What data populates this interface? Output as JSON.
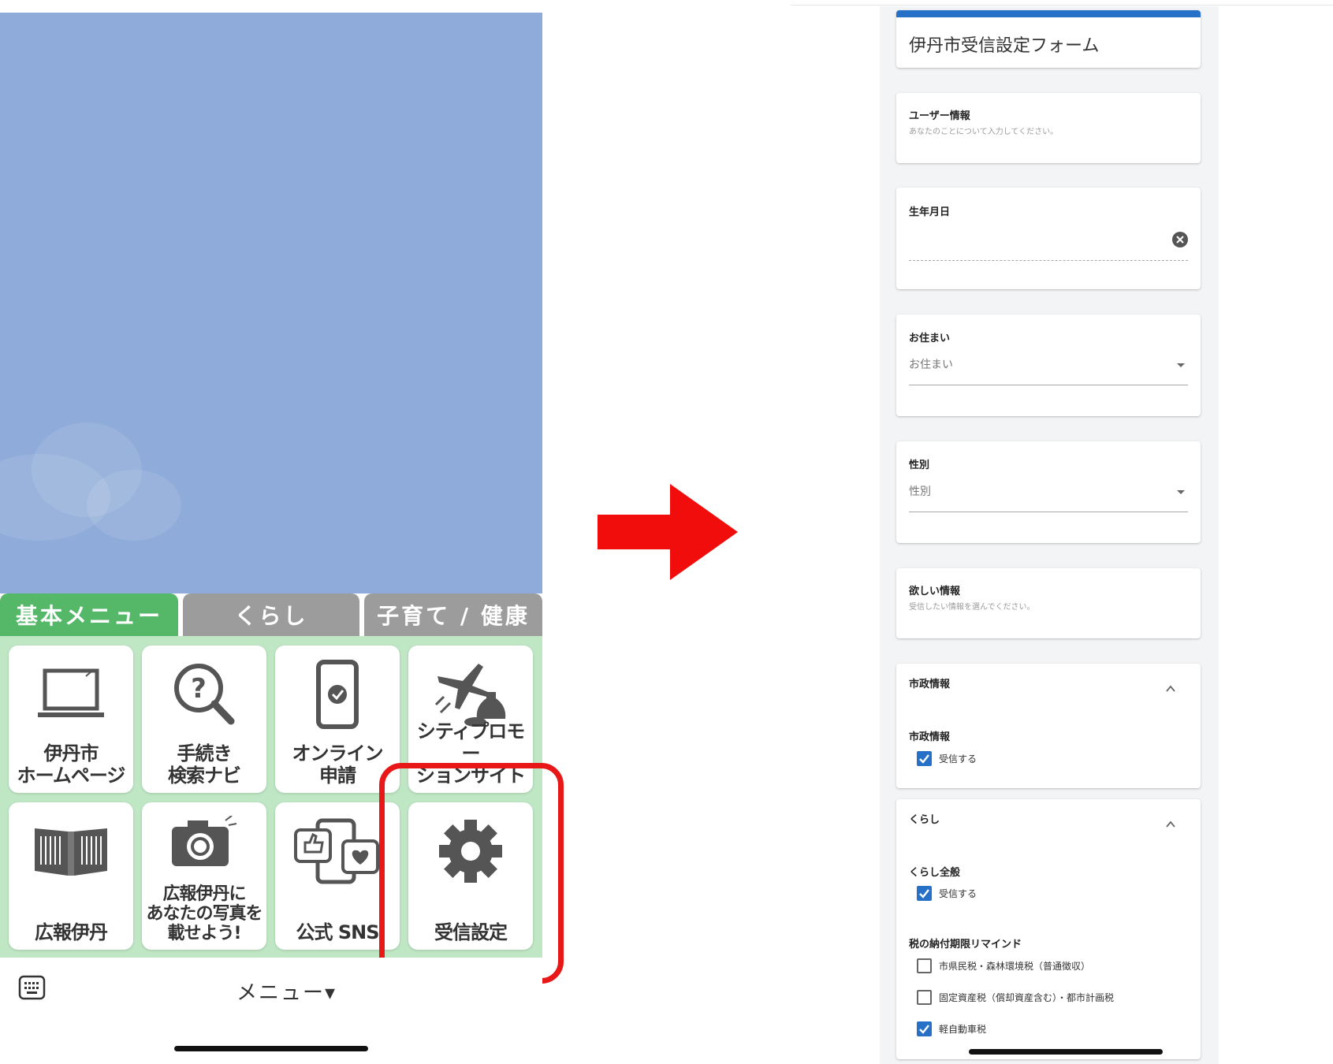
{
  "left": {
    "tabs": [
      "基本メニュー",
      "くらし",
      "子育て / 健康"
    ],
    "tiles": [
      {
        "label": "伊丹市\nホームページ",
        "icon": "laptop-icon"
      },
      {
        "label": "手続き\n検索ナビ",
        "icon": "question-search-icon"
      },
      {
        "label": "オンライン\n申請",
        "icon": "smartphone-check-icon"
      },
      {
        "label": "シティプロモー\nションサイト",
        "icon": "airplane-sake-icon"
      },
      {
        "label": "広報伊丹",
        "icon": "open-book-icon"
      },
      {
        "label": "広報伊丹に\nあなたの写真を\n載せよう!",
        "icon": "camera-icon"
      },
      {
        "label": "公式 SNS",
        "icon": "social-icons"
      },
      {
        "label": "受信設定",
        "icon": "gear-icon"
      }
    ],
    "menu_label": "メニュー▾",
    "colors": {
      "active_tab": "#55b768",
      "inactive_tab": "#9c9c9c",
      "grid_bg": "#bfe7c4",
      "highlight": "#e81818",
      "sky": "#8eabd9"
    }
  },
  "right": {
    "form_title": "伊丹市受信設定フォーム",
    "user_info": {
      "title": "ユーザー情報",
      "desc": "あなたのことについて入力してください。"
    },
    "birthday": {
      "label": "生年月日"
    },
    "residence": {
      "label": "お住まい",
      "placeholder": "お住まい"
    },
    "gender": {
      "label": "性別",
      "placeholder": "性別"
    },
    "wanted": {
      "title": "欲しい情報",
      "desc": "受信したい情報を選んでください。"
    },
    "shisei": {
      "header": "市政情報",
      "item_label": "市政情報",
      "options": [
        {
          "label": "受信する",
          "checked": true
        }
      ]
    },
    "kurashi": {
      "header": "くらし",
      "group1_label": "くらし全般",
      "group1_options": [
        {
          "label": "受信する",
          "checked": true
        }
      ],
      "group2_label": "税の納付期限リマインド",
      "group2_options": [
        {
          "label": "市県民税・森林環境税（普通徴収）",
          "checked": false
        },
        {
          "label": "固定資産税（償却資産含む）・都市計画税",
          "checked": false
        },
        {
          "label": "軽自動車税",
          "checked": true
        }
      ]
    },
    "colors": {
      "accent": "#2671c7"
    }
  }
}
